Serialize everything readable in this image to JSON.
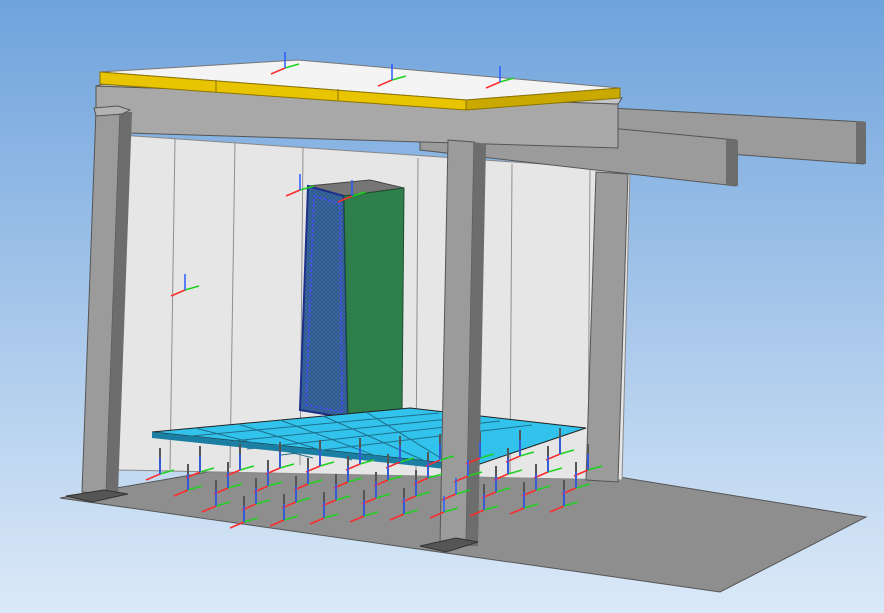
{
  "viewport": {
    "background_top": "#6fa3dc",
    "background_bottom": "#dbe9f8"
  },
  "model": {
    "colors": {
      "steel": "#9b9b9b",
      "steel_dark": "#6d6d6d",
      "steel_light": "#b3b3b3",
      "wall": "#e6e6e6",
      "panel_yellow": "#e9c400",
      "panel_white": "#f4f4f4",
      "floor": "#8e8e8e",
      "platform": "#31c3ec",
      "cabinet_front": "#3a6aa3",
      "cabinet_side": "#2f7f4d",
      "cabinet_top": "#767676"
    },
    "axis_colors": {
      "x": "#ff2b2b",
      "y": "#1fd11f",
      "z": "#2b5cff"
    },
    "axis_triad_count": 42
  }
}
